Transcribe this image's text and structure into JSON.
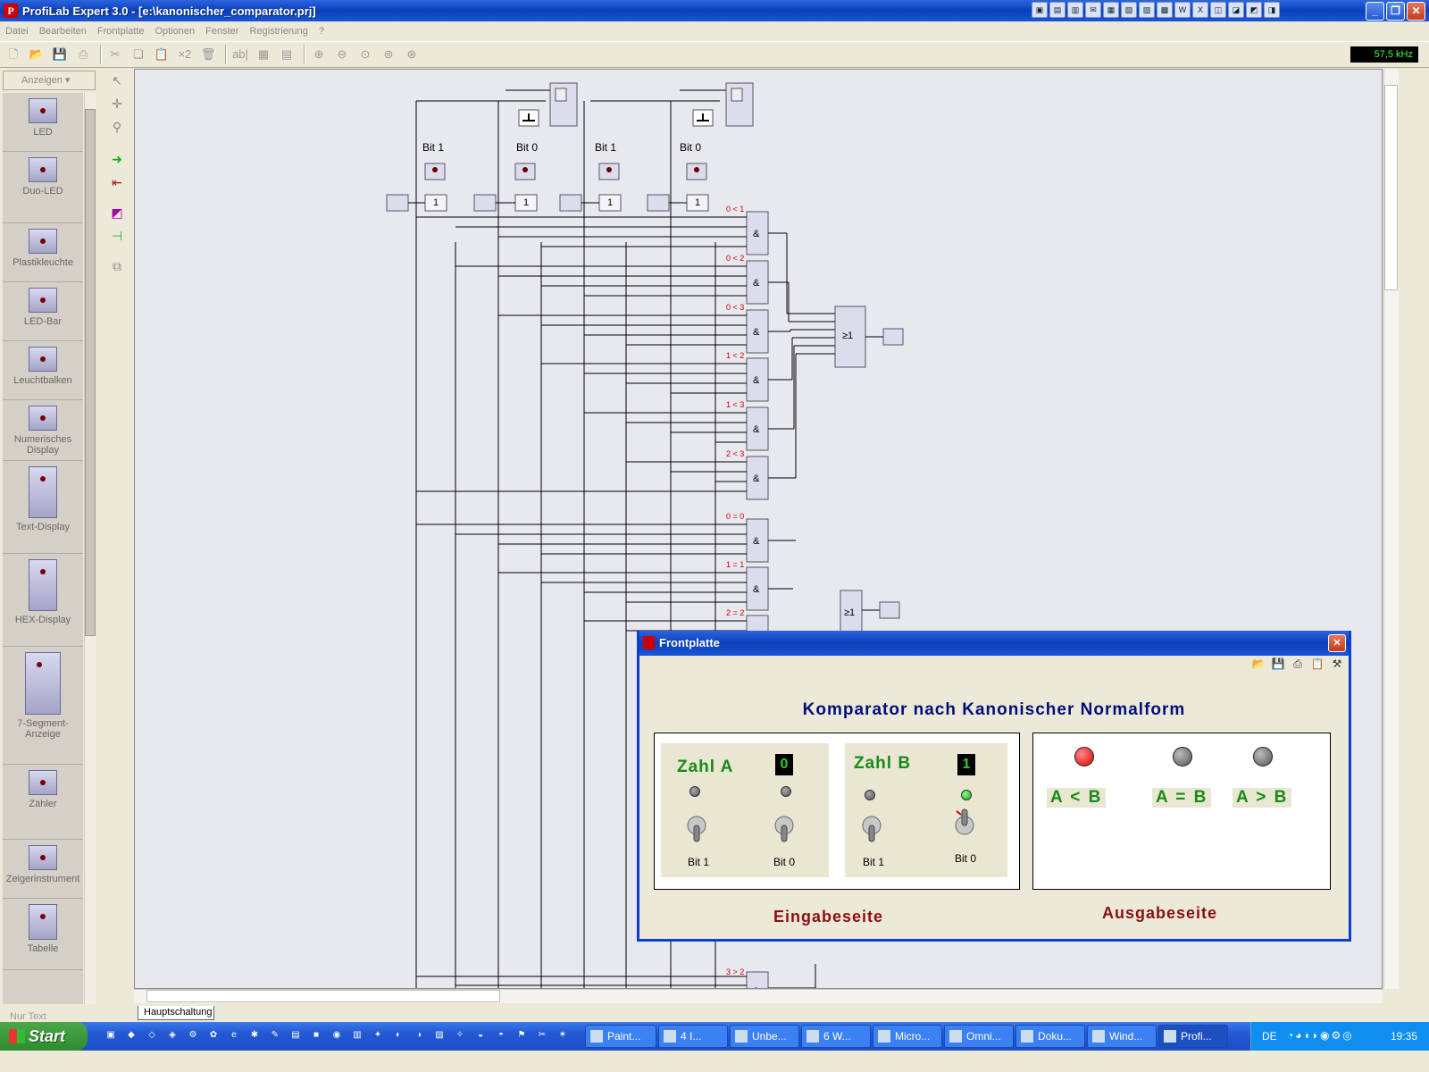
{
  "window": {
    "title": "ProfiLab Expert 3.0 - [e:\\kanonischer_comparator.prj]"
  },
  "menu": [
    "Datei",
    "Bearbeiten",
    "Frontplatte",
    "Optionen",
    "Fenster",
    "Registrierung",
    "?"
  ],
  "toolbar": {
    "frequency": "57,5 kHz"
  },
  "palette": {
    "category": "Anzeigen",
    "items": [
      {
        "label": "LED",
        "code": "LED0"
      },
      {
        "label": "Duo-LED",
        "code": "DLED0"
      },
      {
        "label": "Plastikleuchte",
        "code": "LA0"
      },
      {
        "label": "LED-Bar",
        "code": "LB0"
      },
      {
        "label": "Leuchtbalken",
        "code": "LB0"
      },
      {
        "label": "Numerisches Display",
        "code": "NC0"
      },
      {
        "label": "Text-Display",
        "code": "TC0"
      },
      {
        "label": "HEX-Display",
        "code": "HD0"
      },
      {
        "label": "7-Segment-Anzeige",
        "code": "7Seg0"
      },
      {
        "label": "Zähler",
        "code": "CO0"
      },
      {
        "label": "Zeigerinstrument",
        "code": "IM0"
      },
      {
        "label": "Tabelle",
        "code": "TAB0"
      }
    ],
    "filter": "Nur Text"
  },
  "schematic": {
    "bit_labels": [
      "Bit 1",
      "Bit 0",
      "Bit 1",
      "Bit 0"
    ],
    "gate_labels": [
      "0 < 1",
      "0 < 2",
      "0 < 3",
      "1 < 2",
      "1 < 3",
      "2 < 3",
      "0 = 0",
      "1 = 1",
      "2 = 2",
      "3 > 2"
    ],
    "and_symbol": "&",
    "or_symbol": "≥1",
    "not_symbol": "1",
    "sheet_tab": "Hauptschaltung"
  },
  "frontpanel": {
    "title": "Frontplatte",
    "heading": "Komparator nach Kanonischer Normalform",
    "zahl_a": {
      "label": "Zahl A",
      "value": "0",
      "bits": [
        "Bit 1",
        "Bit 0"
      ],
      "leds": [
        false,
        false
      ]
    },
    "zahl_b": {
      "label": "Zahl B",
      "value": "1",
      "bits": [
        "Bit 1",
        "Bit 0"
      ],
      "leds": [
        false,
        true
      ]
    },
    "outputs": [
      {
        "label": "A < B",
        "on": true
      },
      {
        "label": "A = B",
        "on": false
      },
      {
        "label": "A > B",
        "on": false
      }
    ],
    "input_side": "Eingabeseite",
    "output_side": "Ausgabeseite"
  },
  "taskbar": {
    "start": "Start",
    "tasks": [
      "Paint...",
      "4 I...",
      "Unbe...",
      "6 W...",
      "Micro...",
      "Omni...",
      "Doku...",
      "Wind...",
      "Profi..."
    ],
    "language": "DE",
    "clock": "19:35"
  }
}
